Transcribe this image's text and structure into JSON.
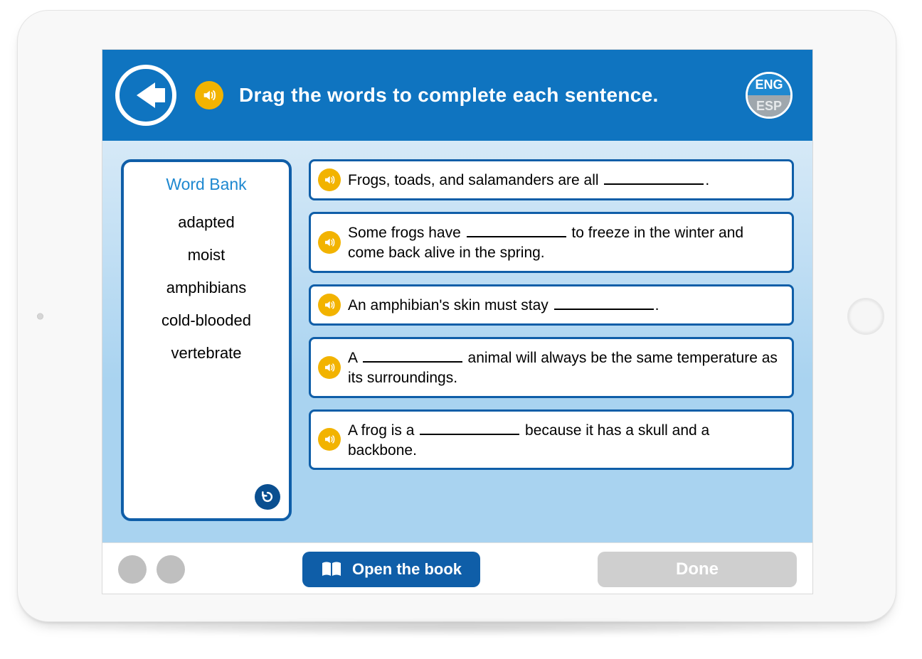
{
  "header": {
    "instruction": "Drag the words to complete each sentence.",
    "lang_primary": "ENG",
    "lang_secondary": "ESP"
  },
  "wordbank": {
    "title": "Word Bank",
    "words": [
      "adapted",
      "moist",
      "amphibians",
      "cold-blooded",
      "vertebrate"
    ]
  },
  "sentences": [
    {
      "pre": "Frogs, toads, and salamanders are all ",
      "post": "."
    },
    {
      "pre": "Some frogs have ",
      "post": " to freeze in the winter and come back alive in the spring."
    },
    {
      "pre": "An amphibian's skin must stay ",
      "post": "."
    },
    {
      "pre": "A ",
      "post": " animal will always be the same temperature as its surroundings."
    },
    {
      "pre": "A frog is a ",
      "post": " because it has a skull and a backbone."
    }
  ],
  "footer": {
    "open_book_label": "Open the book",
    "done_label": "Done"
  }
}
